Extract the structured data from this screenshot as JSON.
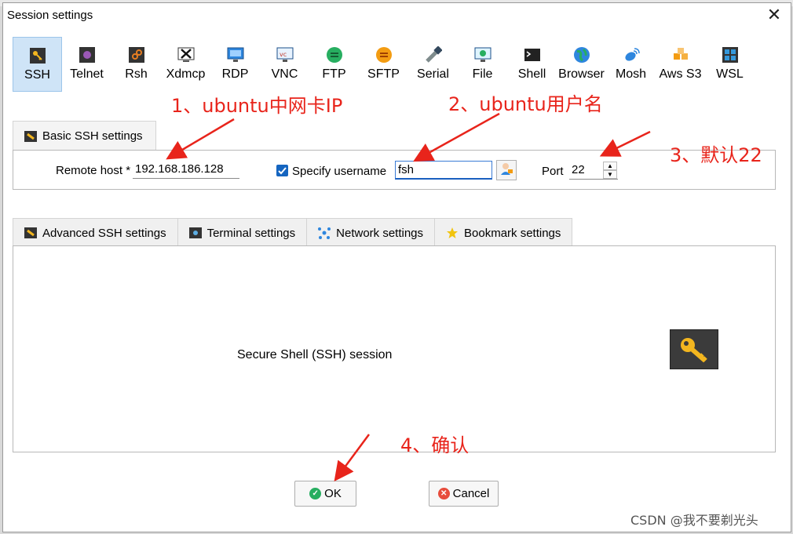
{
  "window": {
    "title": "Session settings",
    "close_label": "✕"
  },
  "protocols": [
    {
      "label": "SSH",
      "icon": "ssh-key-icon",
      "active": true
    },
    {
      "label": "Telnet",
      "icon": "telnet-icon"
    },
    {
      "label": "Rsh",
      "icon": "rsh-icon"
    },
    {
      "label": "Xdmcp",
      "icon": "xdmcp-icon"
    },
    {
      "label": "RDP",
      "icon": "rdp-icon"
    },
    {
      "label": "VNC",
      "icon": "vnc-icon"
    },
    {
      "label": "FTP",
      "icon": "ftp-icon"
    },
    {
      "label": "SFTP",
      "icon": "sftp-icon"
    },
    {
      "label": "Serial",
      "icon": "serial-icon"
    },
    {
      "label": "File",
      "icon": "file-icon"
    },
    {
      "label": "Shell",
      "icon": "shell-icon"
    },
    {
      "label": "Browser",
      "icon": "globe-icon"
    },
    {
      "label": "Mosh",
      "icon": "satellite-icon"
    },
    {
      "label": "Aws S3",
      "icon": "aws-icon"
    },
    {
      "label": "WSL",
      "icon": "windows-icon"
    }
  ],
  "basic": {
    "tab_label": "Basic SSH settings",
    "remote_host_label": "Remote host *",
    "remote_host_value": "192.168.186.128",
    "specify_username_label": "Specify username",
    "specify_username_checked": true,
    "username_value": "fsh",
    "port_label": "Port",
    "port_value": "22"
  },
  "tabs": [
    {
      "label": "Advanced SSH settings",
      "icon": "wrench-icon"
    },
    {
      "label": "Terminal settings",
      "icon": "terminal-icon"
    },
    {
      "label": "Network settings",
      "icon": "network-icon"
    },
    {
      "label": "Bookmark settings",
      "icon": "star-icon"
    }
  ],
  "content": {
    "description": "Secure Shell (SSH) session"
  },
  "buttons": {
    "ok": "OK",
    "cancel": "Cancel"
  },
  "annotations": {
    "a1": "1、ubuntu中网卡IP",
    "a2": "2、ubuntu用户名",
    "a3": "3、默认22",
    "a4": "4、确认"
  },
  "watermark": "CSDN @我不要剃光头",
  "colors": {
    "annotation": "#e8241b",
    "active_tab": "#cfe4f7",
    "accent": "#1565c0"
  }
}
